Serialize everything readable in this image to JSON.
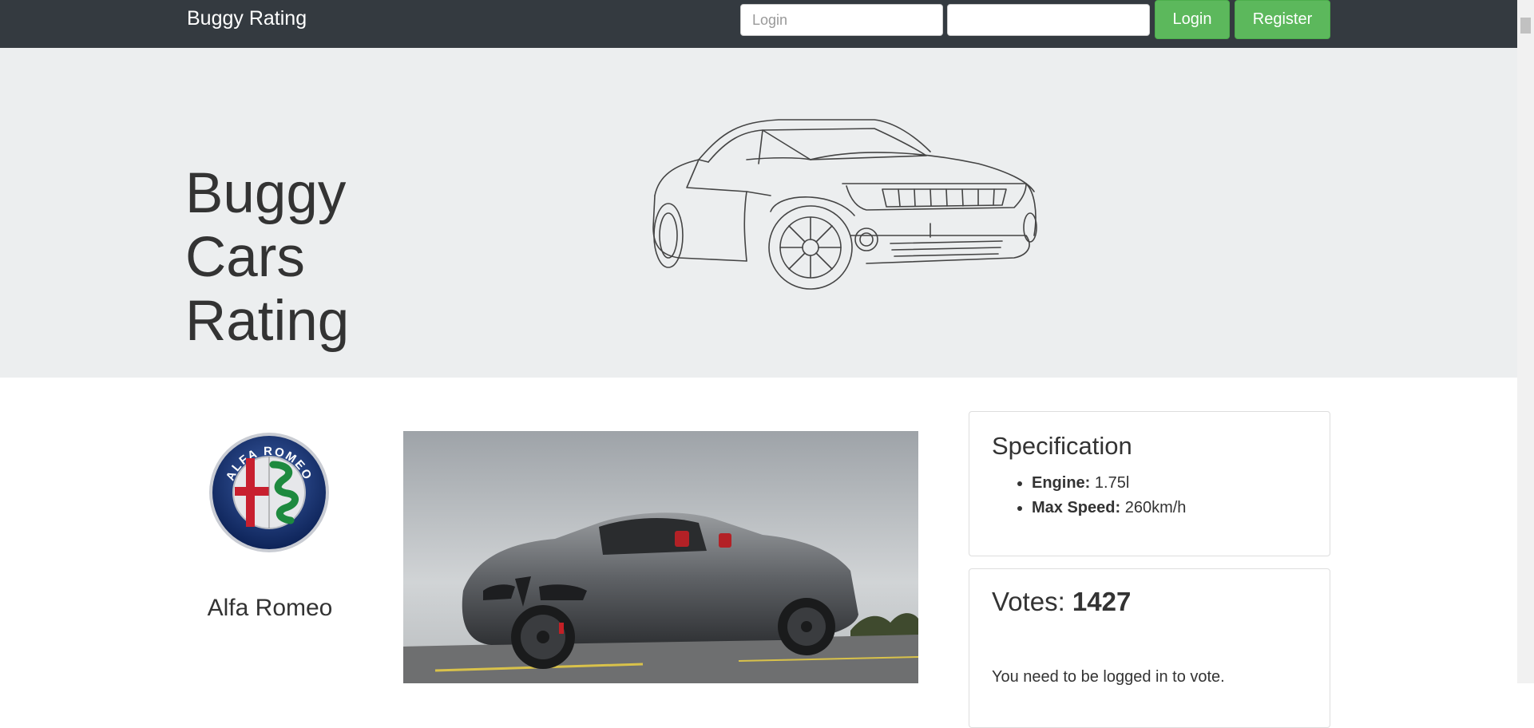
{
  "navbar": {
    "brand": "Buggy Rating",
    "login_placeholder": "Login",
    "password_placeholder": "",
    "login_button": "Login",
    "register_button": "Register"
  },
  "hero": {
    "title": "Buggy Cars Rating"
  },
  "make": {
    "logo_alt": "ALFA ROMEO",
    "name": "Alfa Romeo"
  },
  "specification": {
    "title": "Specification",
    "items": [
      {
        "label": "Engine:",
        "value": "1.75l"
      },
      {
        "label": "Max Speed:",
        "value": "260km/h"
      }
    ]
  },
  "votes": {
    "label": "Votes:",
    "count": "1427",
    "note": "You need to be logged in to vote."
  },
  "colors": {
    "navbar_bg": "#343a40",
    "hero_bg": "#eceeef",
    "button_green": "#5cb85c"
  }
}
